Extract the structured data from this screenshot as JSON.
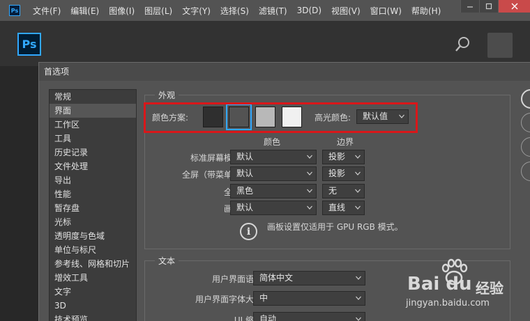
{
  "menubar": {
    "app_icon": "Ps",
    "items": [
      "文件(F)",
      "编辑(E)",
      "图像(I)",
      "图层(L)",
      "文字(Y)",
      "选择(S)",
      "滤镜(T)",
      "3D(D)",
      "视图(V)",
      "窗口(W)",
      "帮助(H)"
    ],
    "window_controls": [
      "minimize-icon",
      "restore-icon",
      "close-icon"
    ]
  },
  "appbar": {
    "logo": "Ps",
    "search_icon": "search-icon"
  },
  "dialog": {
    "title": "首选项",
    "categories": [
      "常规",
      "界面",
      "工作区",
      "工具",
      "历史记录",
      "文件处理",
      "导出",
      "性能",
      "暂存盘",
      "光标",
      "透明度与色域",
      "单位与标尺",
      "参考线、网格和切片",
      "增效工具",
      "文字",
      "3D",
      "技术预览"
    ],
    "selected_category": "界面",
    "appearance": {
      "title": "外观",
      "color_scheme_label": "颜色方案:",
      "swatches": [
        "#2f2f2f",
        "#535353",
        "#b8b8b8",
        "#f0f0f0"
      ],
      "selected_swatch_index": 1,
      "highlight_label": "高光颜色:",
      "highlight_value": "默认值",
      "col_color": "颜色",
      "col_border": "边界",
      "rows": [
        {
          "label": "标准屏幕模式:",
          "color": "默认",
          "border": "投影"
        },
        {
          "label": "全屏（带菜单）:",
          "color": "默认",
          "border": "投影"
        },
        {
          "label": "全屏:",
          "color": "黑色",
          "border": "无"
        },
        {
          "label": "画板:",
          "color": "默认",
          "border": "直线"
        }
      ],
      "info_icon": "i",
      "info_text": "画板设置仅适用于 GPU RGB 模式。"
    },
    "text": {
      "title": "文本",
      "rows": [
        {
          "label": "用户界面语言:",
          "value": "简体中文"
        },
        {
          "label": "用户界面字体大小:",
          "value": "中"
        },
        {
          "label": "UI 缩放:",
          "value": "自动"
        }
      ]
    }
  },
  "watermark": {
    "logo": "Bai du",
    "cn": "经验",
    "url": "jingyan.baidu.com"
  },
  "colors": {
    "highlight_border": "#d9171a",
    "accent": "#31a8ff"
  }
}
